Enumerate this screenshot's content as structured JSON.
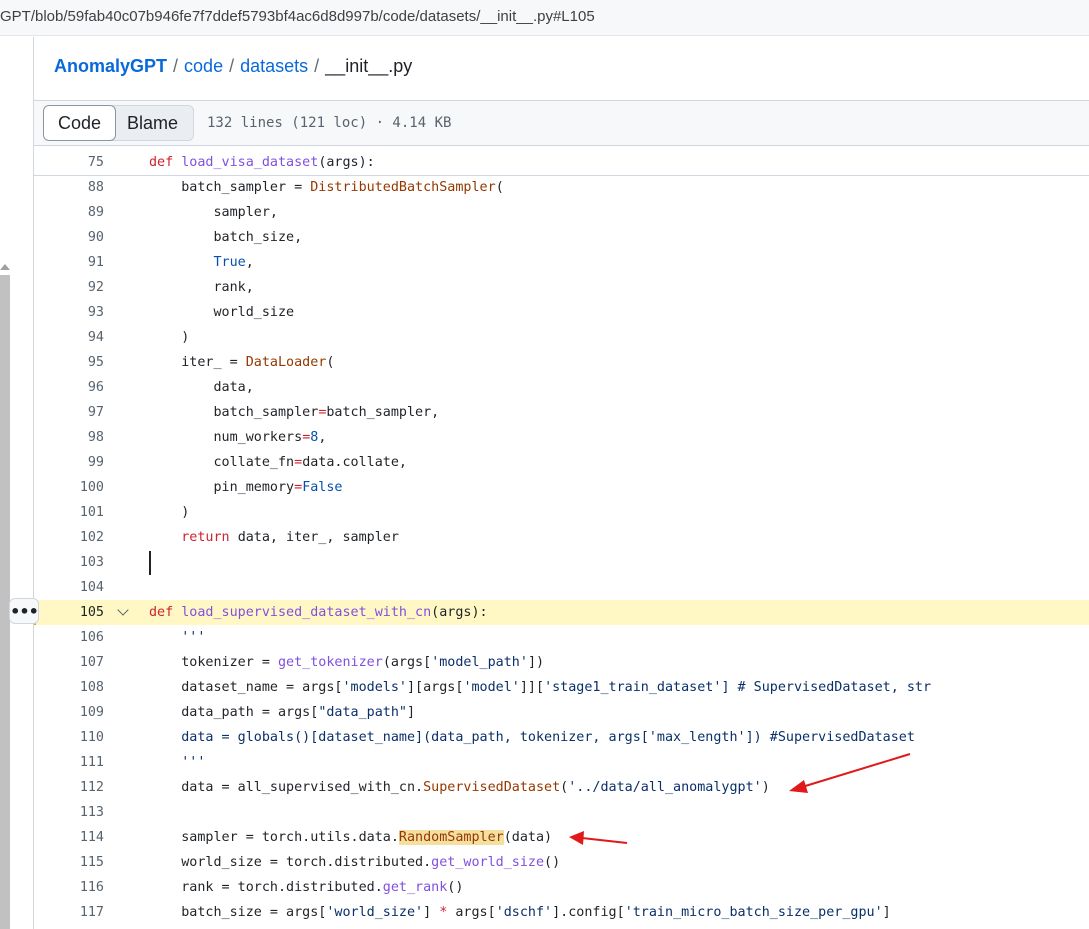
{
  "browser": {
    "url": "GPT/blob/59fab40c07b946fe7f7ddef5793bf4ac6d8d997b/code/datasets/__init__.py#L105"
  },
  "breadcrumb": {
    "repo": "AnomalyGPT",
    "sep": "/",
    "dir1": "code",
    "dir2": "datasets",
    "file": "__init__.py"
  },
  "file_header": {
    "code_tab": "Code",
    "blame_tab": "Blame",
    "info": "132 lines (121 loc) · 4.14 KB"
  },
  "more_button": "•••",
  "code_lines": [
    {
      "num": "75",
      "indent": "",
      "tokens": [
        {
          "t": "def ",
          "c": "kw"
        },
        {
          "t": "load_visa_dataset",
          "c": "fn"
        },
        {
          "t": "(args):",
          "c": ""
        }
      ]
    },
    {
      "num": "88",
      "indent": "    ",
      "tokens": [
        {
          "t": "batch_sampler = ",
          "c": ""
        },
        {
          "t": "DistributedBatchSampler",
          "c": "cls"
        },
        {
          "t": "(",
          "c": ""
        }
      ]
    },
    {
      "num": "89",
      "indent": "        ",
      "tokens": [
        {
          "t": "sampler,",
          "c": ""
        }
      ]
    },
    {
      "num": "90",
      "indent": "        ",
      "tokens": [
        {
          "t": "batch_size,",
          "c": ""
        }
      ]
    },
    {
      "num": "91",
      "indent": "        ",
      "tokens": [
        {
          "t": "True",
          "c": "con"
        },
        {
          "t": ",",
          "c": ""
        }
      ]
    },
    {
      "num": "92",
      "indent": "        ",
      "tokens": [
        {
          "t": "rank,",
          "c": ""
        }
      ]
    },
    {
      "num": "93",
      "indent": "        ",
      "tokens": [
        {
          "t": "world_size",
          "c": ""
        }
      ]
    },
    {
      "num": "94",
      "indent": "    ",
      "tokens": [
        {
          "t": ")",
          "c": ""
        }
      ]
    },
    {
      "num": "95",
      "indent": "    ",
      "tokens": [
        {
          "t": "iter_ = ",
          "c": ""
        },
        {
          "t": "DataLoader",
          "c": "cls"
        },
        {
          "t": "(",
          "c": ""
        }
      ]
    },
    {
      "num": "96",
      "indent": "        ",
      "tokens": [
        {
          "t": "data,",
          "c": ""
        }
      ]
    },
    {
      "num": "97",
      "indent": "        ",
      "tokens": [
        {
          "t": "batch_sampler",
          "c": ""
        },
        {
          "t": "=",
          "c": "kw"
        },
        {
          "t": "batch_sampler,",
          "c": ""
        }
      ]
    },
    {
      "num": "98",
      "indent": "        ",
      "tokens": [
        {
          "t": "num_workers",
          "c": ""
        },
        {
          "t": "=",
          "c": "kw"
        },
        {
          "t": "8",
          "c": "con"
        },
        {
          "t": ",",
          "c": ""
        }
      ]
    },
    {
      "num": "99",
      "indent": "        ",
      "tokens": [
        {
          "t": "collate_fn",
          "c": ""
        },
        {
          "t": "=",
          "c": "kw"
        },
        {
          "t": "data.collate,",
          "c": ""
        }
      ]
    },
    {
      "num": "100",
      "indent": "        ",
      "tokens": [
        {
          "t": "pin_memory",
          "c": ""
        },
        {
          "t": "=",
          "c": "kw"
        },
        {
          "t": "False",
          "c": "con"
        }
      ]
    },
    {
      "num": "101",
      "indent": "    ",
      "tokens": [
        {
          "t": ")",
          "c": ""
        }
      ]
    },
    {
      "num": "102",
      "indent": "    ",
      "tokens": [
        {
          "t": "return ",
          "c": "kw"
        },
        {
          "t": "data, iter_, sampler",
          "c": ""
        }
      ]
    },
    {
      "num": "103",
      "indent": "",
      "tokens": []
    },
    {
      "num": "104",
      "indent": "",
      "tokens": []
    },
    {
      "num": "105",
      "indent": "",
      "tokens": [
        {
          "t": "def ",
          "c": "kw"
        },
        {
          "t": "load_supervised_dataset_with_cn",
          "c": "fn"
        },
        {
          "t": "(args):",
          "c": ""
        }
      ]
    },
    {
      "num": "106",
      "indent": "    ",
      "tokens": [
        {
          "t": "'''",
          "c": "str"
        }
      ]
    },
    {
      "num": "107",
      "indent": "    ",
      "tokens": [
        {
          "t": "tokenizer = ",
          "c": ""
        },
        {
          "t": "get_tokenizer",
          "c": "fn"
        },
        {
          "t": "(args[",
          "c": ""
        },
        {
          "t": "'model_path'",
          "c": "str"
        },
        {
          "t": "])",
          "c": ""
        }
      ]
    },
    {
      "num": "108",
      "indent": "    ",
      "tokens": [
        {
          "t": "dataset_name = args[",
          "c": ""
        },
        {
          "t": "'models'",
          "c": "str"
        },
        {
          "t": "][args[",
          "c": ""
        },
        {
          "t": "'model'",
          "c": "str"
        },
        {
          "t": "]][",
          "c": ""
        },
        {
          "t": "'stage1_train_dataset'",
          "c": "str"
        },
        {
          "t": "] # SupervisedDataset, str",
          "c": "str"
        }
      ]
    },
    {
      "num": "109",
      "indent": "    ",
      "tokens": [
        {
          "t": "data_path = args[",
          "c": ""
        },
        {
          "t": "\"data_path\"",
          "c": "str"
        },
        {
          "t": "]",
          "c": ""
        }
      ]
    },
    {
      "num": "110",
      "indent": "    ",
      "tokens": [
        {
          "t": "data = globals()[dataset_name](data_path, tokenizer, args[",
          "c": "str"
        },
        {
          "t": "'max_length'",
          "c": "str"
        },
        {
          "t": "]) #SupervisedDataset",
          "c": "str"
        }
      ]
    },
    {
      "num": "111",
      "indent": "    ",
      "tokens": [
        {
          "t": "'''",
          "c": "str"
        }
      ]
    },
    {
      "num": "112",
      "indent": "    ",
      "tokens": [
        {
          "t": "data = all_supervised_with_cn.",
          "c": ""
        },
        {
          "t": "SupervisedDataset",
          "c": "cls"
        },
        {
          "t": "(",
          "c": ""
        },
        {
          "t": "'../data/all_anomalygpt'",
          "c": "str"
        },
        {
          "t": ")",
          "c": ""
        }
      ]
    },
    {
      "num": "113",
      "indent": "",
      "tokens": []
    },
    {
      "num": "114",
      "indent": "    ",
      "tokens": [
        {
          "t": "sampler = torch.utils.data.",
          "c": ""
        },
        {
          "t": "RandomSampler",
          "c": "cls mark"
        },
        {
          "t": "(data)",
          "c": ""
        }
      ]
    },
    {
      "num": "115",
      "indent": "    ",
      "tokens": [
        {
          "t": "world_size = torch.distributed.",
          "c": ""
        },
        {
          "t": "get_world_size",
          "c": "fn"
        },
        {
          "t": "()",
          "c": ""
        }
      ]
    },
    {
      "num": "116",
      "indent": "    ",
      "tokens": [
        {
          "t": "rank = torch.distributed.",
          "c": ""
        },
        {
          "t": "get_rank",
          "c": "fn"
        },
        {
          "t": "()",
          "c": ""
        }
      ]
    },
    {
      "num": "117",
      "indent": "    ",
      "tokens": [
        {
          "t": "batch_size = args[",
          "c": ""
        },
        {
          "t": "'world_size'",
          "c": "str"
        },
        {
          "t": "] ",
          "c": ""
        },
        {
          "t": "*",
          "c": "kw"
        },
        {
          "t": " args[",
          "c": ""
        },
        {
          "t": "'dschf'",
          "c": "str"
        },
        {
          "t": "].config[",
          "c": ""
        },
        {
          "t": "'train_micro_batch_size_per_gpu'",
          "c": "str"
        },
        {
          "t": "]",
          "c": ""
        }
      ]
    }
  ],
  "highlighted_line": "105",
  "colors": {
    "keyword": "#cf222e",
    "function": "#8250df",
    "class": "#953800",
    "constant": "#0550ae",
    "string": "#0a3069",
    "highlight": "#fff8c5",
    "annotation_arrow": "#e0191b"
  }
}
